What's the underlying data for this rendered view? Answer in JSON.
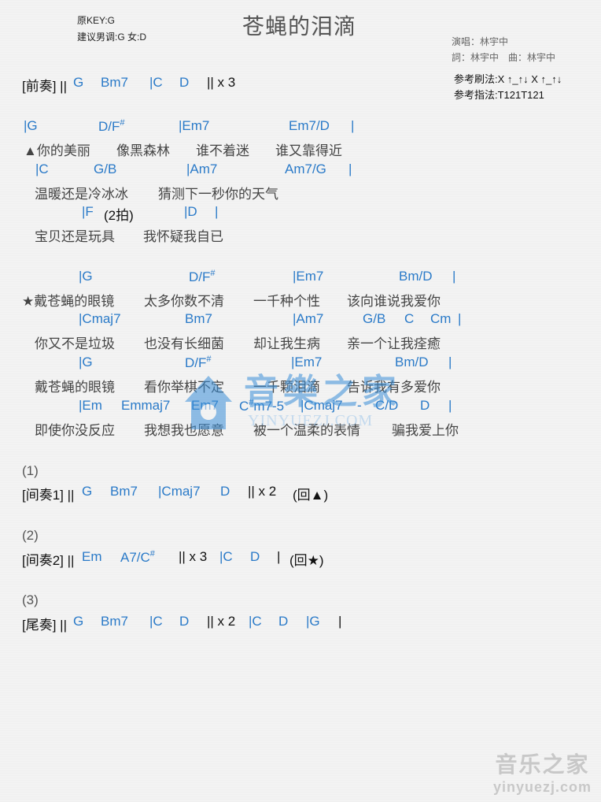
{
  "header": {
    "title": "苍蝇的泪滴",
    "original_key": "原KEY:G",
    "suggested_key": "建议男调:G 女:D",
    "singer": "演唱：林宇中",
    "writers": "詞：林宇中　曲：林宇中",
    "strum": "参考刷法:X ↑_↑↓ X ↑_↑↓",
    "finger": "参考指法:T121T121"
  },
  "intro": {
    "label": "[前奏] ||",
    "chords": [
      "G",
      "Bm7",
      "|C",
      "D"
    ],
    "repeat": "|| x 3"
  },
  "verse": {
    "chords1": [
      "|G",
      "D/F",
      "|Em7",
      "Em7/D",
      "|"
    ],
    "lyrics1": [
      "▲你的美丽",
      "像黑森林",
      "谁不着迷",
      "谁又靠得近"
    ],
    "chords2": [
      "|C",
      "G/B",
      "|Am7",
      "Am7/G",
      "|"
    ],
    "lyrics2": [
      "温暖还是冷冰冰",
      "猜测下一秒你的天气"
    ],
    "chords3": [
      "|F",
      "(2拍)",
      "|D",
      "|"
    ],
    "lyrics3": [
      "宝贝还是玩具",
      "我怀疑我自已"
    ]
  },
  "chorus": {
    "chords1": [
      "|G",
      "D/F",
      "|Em7",
      "Bm/D",
      "|"
    ],
    "lyrics1": [
      "★戴苍蝇的眼镜",
      "太多你数不清",
      "一千种个性",
      "该向谁说我爱你"
    ],
    "chords2": [
      "|Cmaj7",
      "Bm7",
      "|Am7",
      "G/B",
      "C",
      "Cm",
      "|"
    ],
    "lyrics2": [
      "你又不是垃圾",
      "也没有长细菌",
      "却让我生病",
      "亲一个让我痊癒"
    ],
    "chords3": [
      "|G",
      "D/F",
      "|Em7",
      "Bm/D",
      "|"
    ],
    "lyrics3": [
      "戴苍蝇的眼镜",
      "看你举棋不定",
      "一千颗泪滴",
      "告诉我有多爱你"
    ],
    "chords4": [
      "|Em",
      "Emmaj7",
      "Em7",
      "C",
      "m7-5",
      "|Cmaj7",
      "-",
      "C/D",
      "D",
      "|"
    ],
    "lyrics4": [
      "即使你没反应",
      "我想我也愿意",
      "被一个温柔的表情",
      "骗我爱上你"
    ]
  },
  "sharp": "#",
  "interlude1": {
    "number": "(1)",
    "label": "[间奏1] ||",
    "chords": [
      "G",
      "Bm7",
      "|Cmaj7",
      "D"
    ],
    "repeat": "|| x 2",
    "note": "(回▲)"
  },
  "interlude2": {
    "number": "(2)",
    "label": "[间奏2] ||",
    "chords": [
      "Em",
      "A7/C",
      "|C",
      "D"
    ],
    "repeat": "|| x 3",
    "bar": "|",
    "note": "(回★)"
  },
  "outro": {
    "number": "(3)",
    "label": "[尾奏] ||",
    "chords": [
      "G",
      "Bm7",
      "|C",
      "D",
      "|C",
      "D",
      "|G"
    ],
    "repeat": "|| x 2",
    "bar": "|"
  },
  "watermark": {
    "center_cn": "音樂之家",
    "center_en": "YINYUEZJ.COM",
    "corner_cn": "音乐之家",
    "corner_en": "yinyuezj.com"
  }
}
